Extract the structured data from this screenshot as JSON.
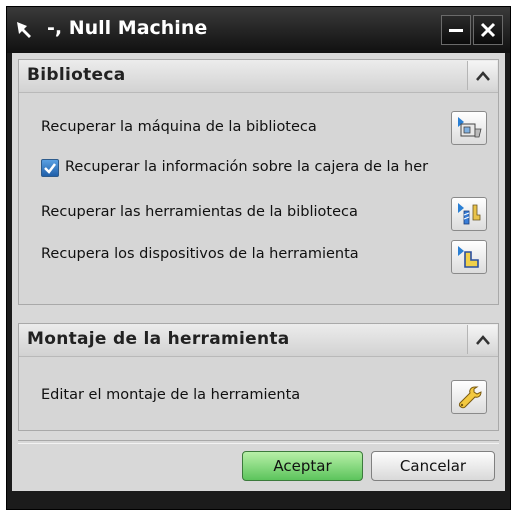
{
  "window": {
    "title": "-, Null Machine"
  },
  "sections": {
    "biblioteca": {
      "title": "Biblioteca",
      "retrieve_machine_label": "Recuperar la máquina de la biblioteca",
      "retrieve_magazine_label": "Recuperar la información sobre la cajera de la her",
      "retrieve_magazine_checked": true,
      "retrieve_tools_label": "Recuperar las herramientas de la biblioteca",
      "retrieve_devices_label": "Recupera los dispositivos de la herramienta"
    },
    "montaje": {
      "title": "Montaje de la herramienta",
      "edit_assembly_label": "Editar el montaje de la herramienta"
    }
  },
  "footer": {
    "ok_label": "Aceptar",
    "cancel_label": "Cancelar"
  },
  "icons": {
    "pin": "pin-icon",
    "minimize": "minimize-icon",
    "close": "close-icon",
    "collapse": "chevron-up-icon",
    "machine": "machine-library-icon",
    "tools": "tool-library-icon",
    "devices": "device-library-icon",
    "wrench": "wrench-icon"
  },
  "colors": {
    "title_bar": "#1b1b1b",
    "ok_button": "#5cc45c",
    "checkbox": "#1f5fa9"
  }
}
